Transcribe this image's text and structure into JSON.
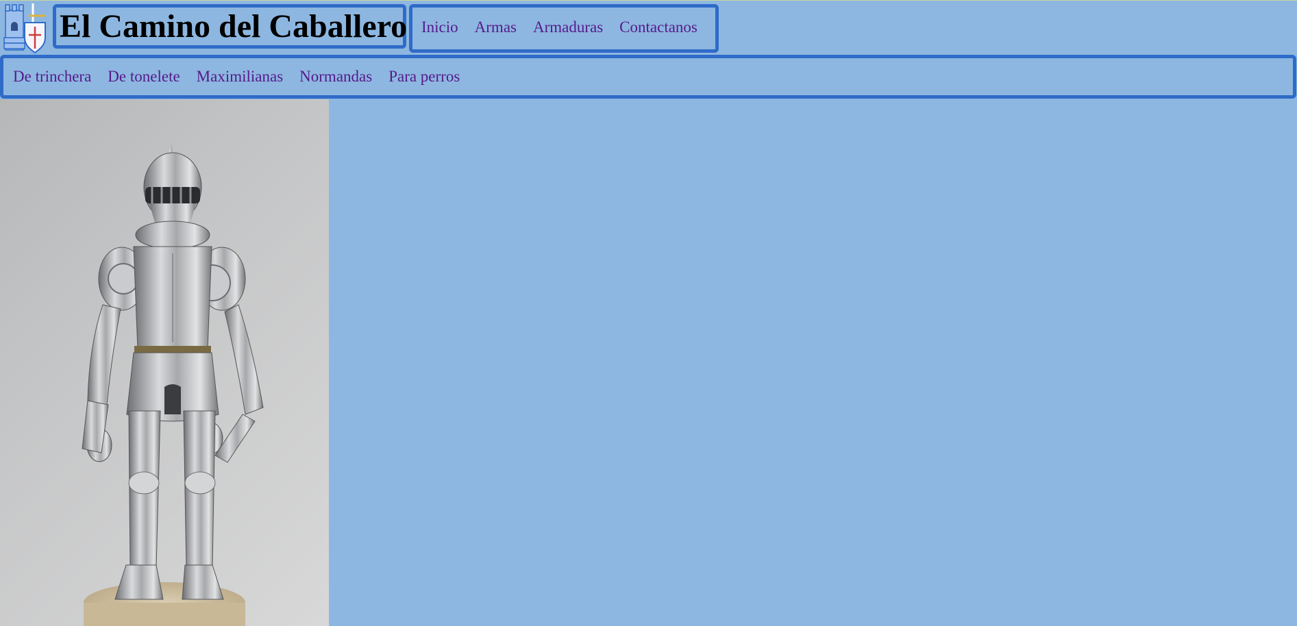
{
  "header": {
    "title": "El Camino del Caballero",
    "logo_icon": "castle-shield-logo-icon"
  },
  "main_nav": {
    "items": [
      {
        "label": "Inicio"
      },
      {
        "label": "Armas"
      },
      {
        "label": "Armaduras"
      },
      {
        "label": "Contactanos"
      }
    ]
  },
  "sub_nav": {
    "items": [
      {
        "label": "De trinchera"
      },
      {
        "label": "De tonelete"
      },
      {
        "label": "Maximilianas"
      },
      {
        "label": "Normandas"
      },
      {
        "label": "Para perros"
      }
    ]
  },
  "hero": {
    "image_icon": "knight-armor-image"
  },
  "colors": {
    "background": "#8db7e0",
    "border": "#2f6bc8",
    "link": "#551a8b",
    "title": "#000000"
  }
}
